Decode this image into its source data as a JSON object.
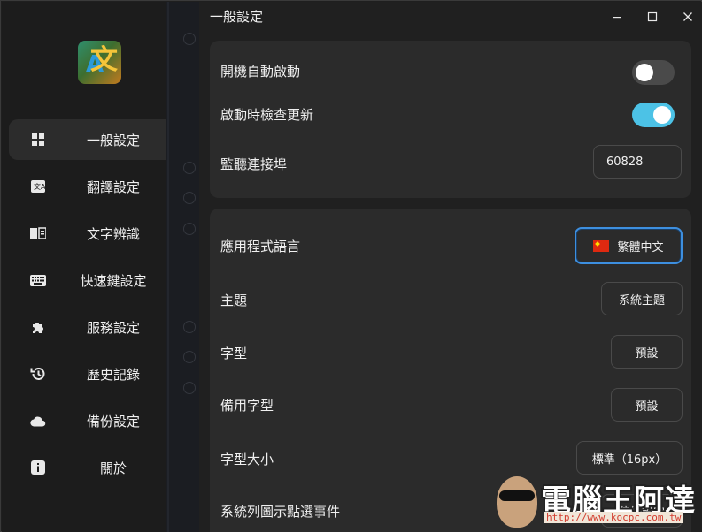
{
  "window": {
    "title": "一般設定",
    "controls": [
      "minimize",
      "maximize",
      "close"
    ]
  },
  "sidebar": {
    "items": [
      {
        "label": "一般設定",
        "icon": "grid-icon",
        "active": true
      },
      {
        "label": "翻譯設定",
        "icon": "translate-icon",
        "active": false
      },
      {
        "label": "文字辨識",
        "icon": "ocr-icon",
        "active": false
      },
      {
        "label": "快速鍵設定",
        "icon": "keyboard-icon",
        "active": false
      },
      {
        "label": "服務設定",
        "icon": "puzzle-icon",
        "active": false
      },
      {
        "label": "歷史記錄",
        "icon": "history-icon",
        "active": false
      },
      {
        "label": "備份設定",
        "icon": "cloud-icon",
        "active": false
      },
      {
        "label": "關於",
        "icon": "info-icon",
        "active": false
      }
    ]
  },
  "general": {
    "auto_start": {
      "label": "開機自動啟動",
      "enabled": false
    },
    "check_update": {
      "label": "啟動時檢查更新",
      "enabled": true
    },
    "port": {
      "label": "監聽連接埠",
      "value": "60828"
    }
  },
  "appearance": {
    "language": {
      "label": "應用程式語言",
      "value": "繁體中文",
      "flag_color": "#de2910"
    },
    "theme": {
      "label": "主題",
      "value": "系統主題"
    },
    "font": {
      "label": "字型",
      "value": "預設"
    },
    "fallback_font": {
      "label": "備用字型",
      "value": "預設"
    },
    "font_size": {
      "label": "字型大小",
      "value": "標準（16px）"
    },
    "tray_click": {
      "label": "系統列圖示點選事件",
      "value": "偏好設定"
    }
  },
  "colors": {
    "accent": "#4cc2e6",
    "focus_border": "#3d8fe0",
    "background": "#202020",
    "card": "#2b2b2b"
  },
  "watermark": {
    "text": "電腦王阿達",
    "url": "http://www.kocpc.com.tw"
  }
}
